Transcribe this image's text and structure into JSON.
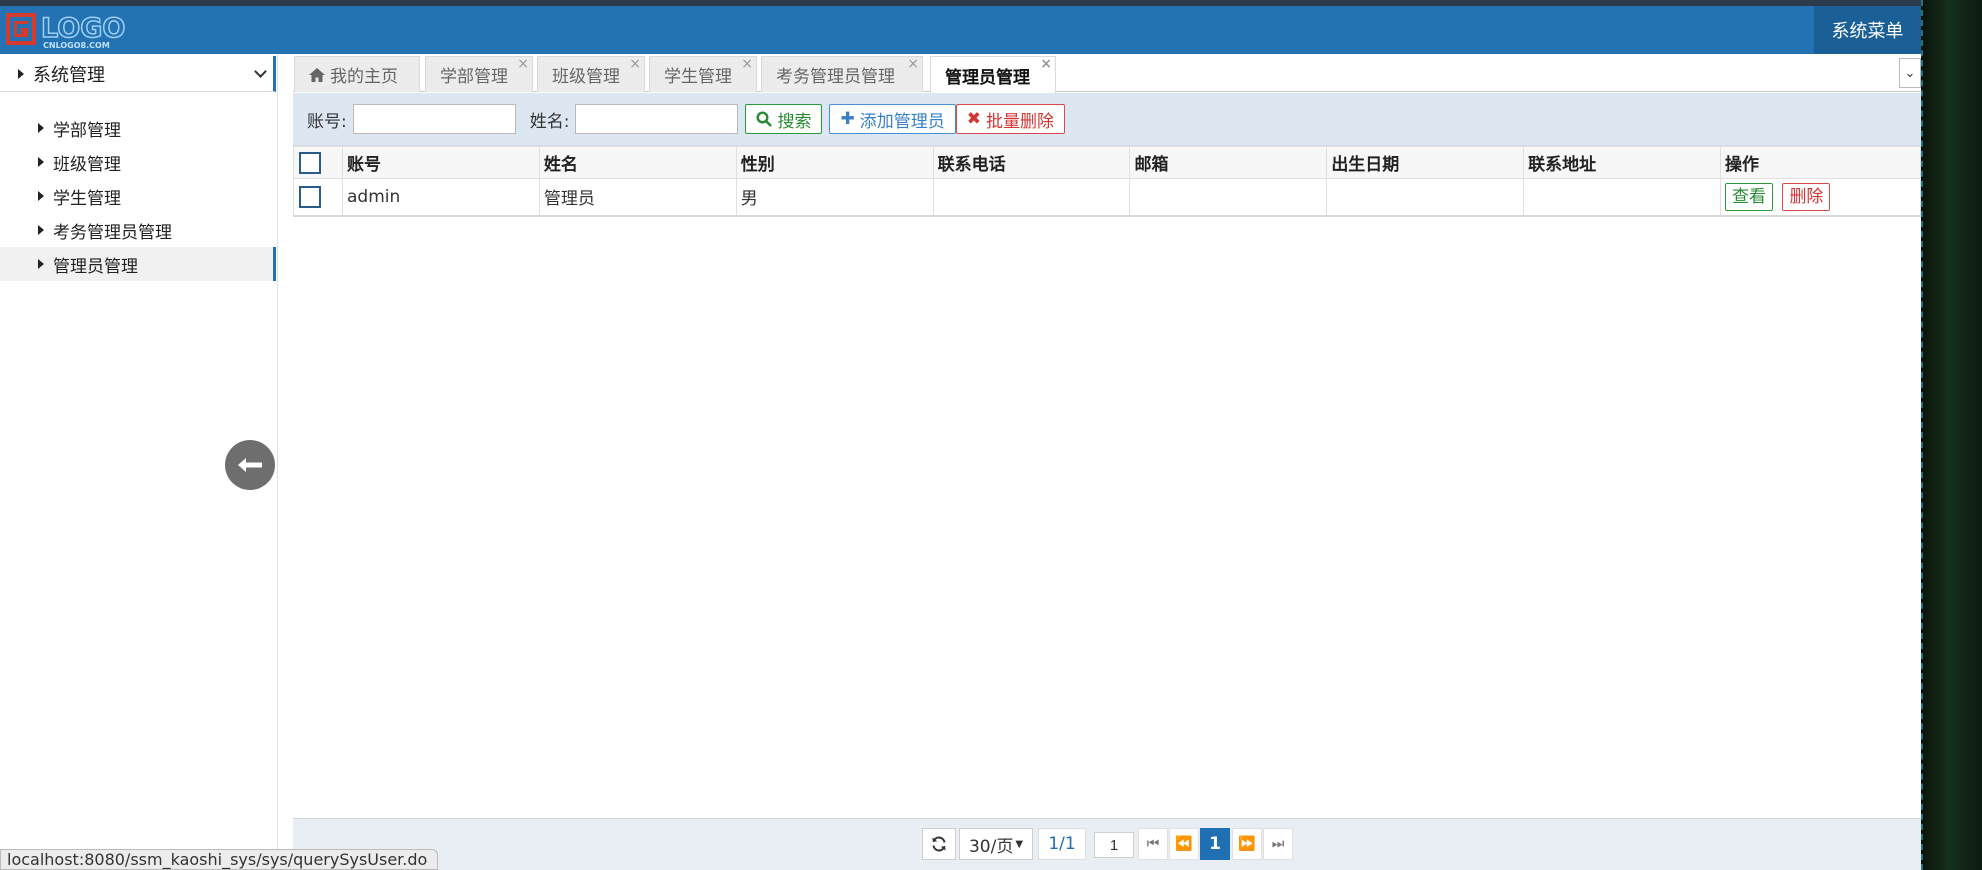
{
  "header": {
    "logo_text": "LOGO",
    "logo_sub": "CNLOGO8.COM",
    "menu_label": "系统菜单"
  },
  "sidebar": {
    "group_label": "系统管理",
    "items": [
      {
        "label": "学部管理"
      },
      {
        "label": "班级管理"
      },
      {
        "label": "学生管理"
      },
      {
        "label": "考务管理员管理"
      },
      {
        "label": "管理员管理",
        "active": true
      }
    ]
  },
  "tabs": [
    {
      "label": "我的主页",
      "closable": false
    },
    {
      "label": "学部管理",
      "closable": true
    },
    {
      "label": "班级管理",
      "closable": true
    },
    {
      "label": "学生管理",
      "closable": true
    },
    {
      "label": "考务管理员管理",
      "closable": true
    },
    {
      "label": "管理员管理",
      "closable": true,
      "active": true
    }
  ],
  "toolbar": {
    "account_label": "账号:",
    "account_value": "",
    "name_label": "姓名:",
    "name_value": "",
    "search_label": "搜索",
    "add_label": "添加管理员",
    "batch_delete_label": "批量删除"
  },
  "table": {
    "columns": [
      "账号",
      "姓名",
      "性别",
      "联系电话",
      "邮箱",
      "出生日期",
      "联系地址",
      "操作"
    ],
    "rows": [
      {
        "account": "admin",
        "name": "管理员",
        "gender": "男",
        "phone": "",
        "email": "",
        "birthday": "",
        "address": "",
        "view_label": "查看",
        "delete_label": "删除"
      }
    ]
  },
  "pager": {
    "page_size": "30/页",
    "page_info": "1/1",
    "page_input": "1",
    "current_page": "1"
  },
  "status_url": "localhost:8080/ssm_kaoshi_sys/sys/querySysUser.do",
  "colors": {
    "header": "#2372b4",
    "accent": "#1f6fb2",
    "success": "#2a8a34",
    "danger": "#d23535"
  }
}
